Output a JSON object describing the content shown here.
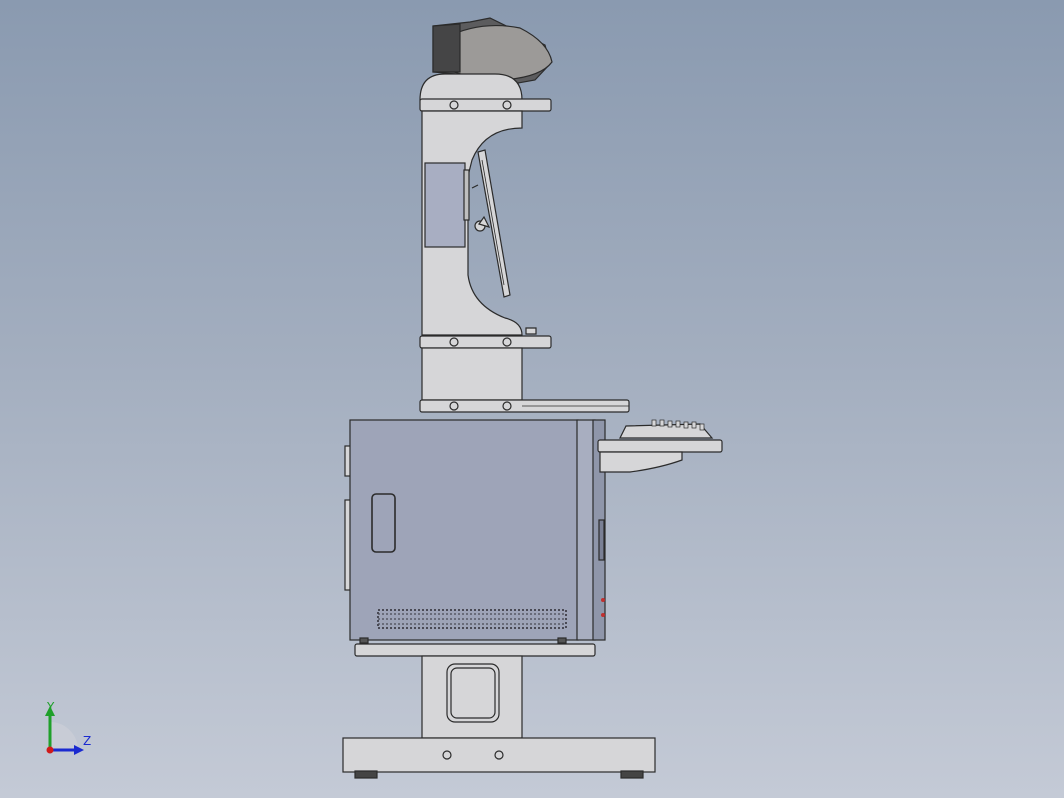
{
  "viewport": {
    "background_top": "#8a9ab0",
    "background_bottom": "#c4cad6",
    "part_fill": "#d6d6d8",
    "cabinet_fill": "#9ea4b8",
    "edge_color": "#2b2b2b"
  },
  "triad": {
    "y_label": "Y",
    "z_label": "Z",
    "y_color": "#1fa02a",
    "z_color": "#1a2ad0",
    "x_color": "#d01a1a"
  }
}
